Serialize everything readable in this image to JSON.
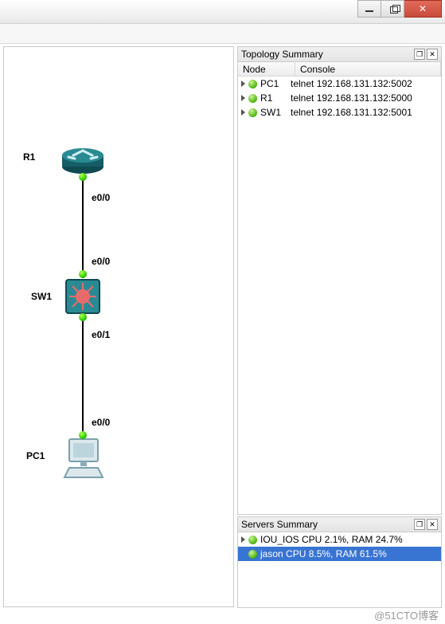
{
  "window": {
    "min_tooltip": "Minimize",
    "max_tooltip": "Restore",
    "close_tooltip": "Close"
  },
  "topology_panel": {
    "title": "Topology Summary",
    "columns": {
      "node": "Node",
      "console": "Console"
    },
    "rows": [
      {
        "name": "PC1",
        "console": "telnet 192.168.131.132:5002"
      },
      {
        "name": "R1",
        "console": "telnet 192.168.131.132:5000"
      },
      {
        "name": "SW1",
        "console": "telnet 192.168.131.132:5001"
      }
    ]
  },
  "servers_panel": {
    "title": "Servers Summary",
    "rows": [
      {
        "text": "IOU_IOS CPU 2.1%, RAM 24.7%",
        "selected": false
      },
      {
        "text": "jason CPU 8.5%, RAM 61.5%",
        "selected": true
      }
    ]
  },
  "canvas": {
    "devices": {
      "r1": {
        "label": "R1"
      },
      "sw1": {
        "label": "SW1"
      },
      "pc1": {
        "label": "PC1"
      }
    },
    "interfaces": {
      "r1_e00": "e0/0",
      "sw1_e00": "e0/0",
      "sw1_e01": "e0/1",
      "pc1_e00": "e0/0"
    }
  },
  "watermark": "@51CTO博客"
}
